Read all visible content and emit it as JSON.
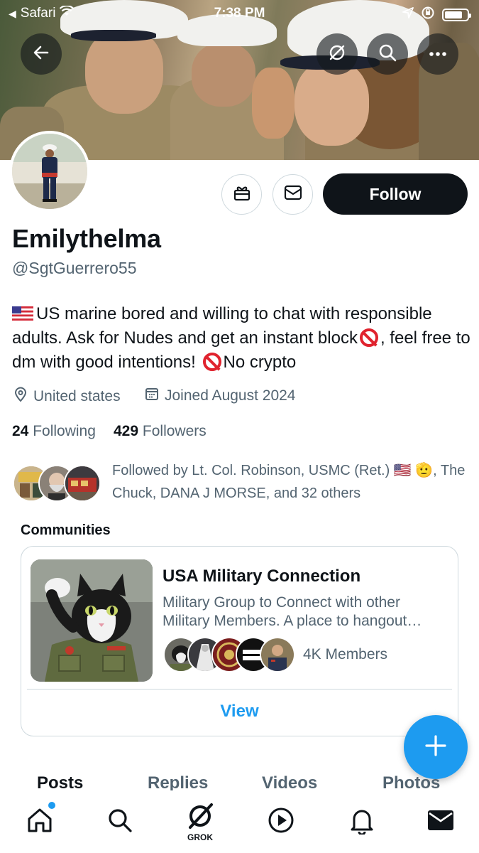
{
  "status_bar": {
    "back_app": "Safari",
    "time": "7:38 PM"
  },
  "header_icons": [
    "back-arrow-icon",
    "grok-icon",
    "search-icon",
    "more-icon"
  ],
  "profile": {
    "display_name": "Emilythelma",
    "handle": "@SgtGuerrero55",
    "bio_part1": "US marine bored and willing to chat with responsible adults. Ask for Nudes and get an instant block",
    "bio_part2": ", feel free to dm with good intentions!",
    "bio_part3": "No crypto",
    "location": "United states",
    "joined": "Joined August 2024",
    "following_count": "24",
    "following_label": "Following",
    "followers_count": "429",
    "followers_label": "Followers",
    "followed_by_text": "Followed by Lt. Col. Robinson, USMC (Ret.) 🇺🇸 🫡, The Chuck, DANA J MORSE, and 32 others"
  },
  "actions": {
    "follow_label": "Follow"
  },
  "communities": {
    "section_label": "Communities",
    "card": {
      "title": "USA Military Connection",
      "description": "Military Group to Connect with other Military Members. A place to hangout…",
      "members": "4K Members",
      "view_label": "View"
    }
  },
  "tabs": [
    "Posts",
    "Replies",
    "Videos",
    "Photos"
  ],
  "bottom_nav": {
    "grok_label": "GROK",
    "items": [
      "home-icon",
      "search-icon",
      "grok-icon",
      "video-icon",
      "bell-icon",
      "mail-icon"
    ]
  },
  "colors": {
    "accent": "#1d9bf0",
    "text_primary": "#0f1419",
    "text_secondary": "#536471",
    "follow_button": "#0f1419"
  }
}
